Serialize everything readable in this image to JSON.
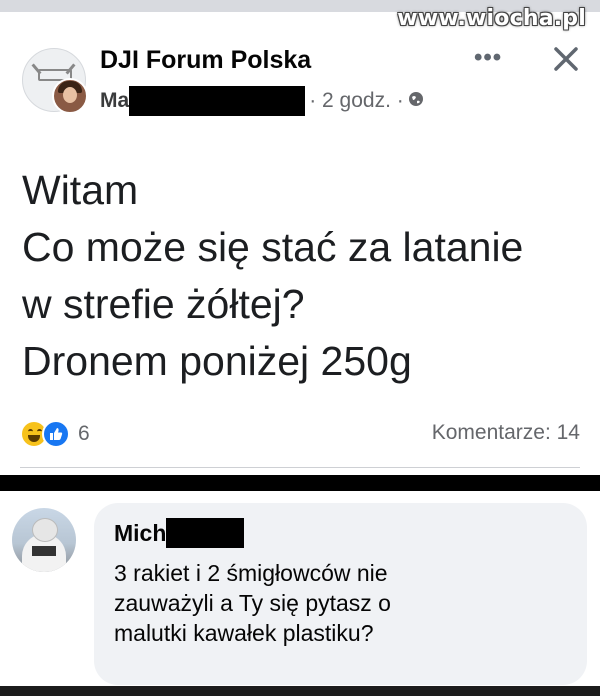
{
  "watermark": "www.wiocha.pl",
  "post": {
    "group_name": "DJI Forum Polska",
    "author_visible": "Ma",
    "time": "· 2 godz. ·",
    "lines": [
      "Witam",
      "Co może się stać za latanie",
      "w strefie żółtej?",
      "Dronem poniżej 250g"
    ],
    "reaction_count": "6",
    "comments_label": "Komentarze: 14"
  },
  "comment": {
    "author_visible": "Mich",
    "lines": [
      "3 rakiet i 2 śmigłowców nie",
      "zauważyli a Ty się pytasz o",
      "malutki kawałek plastiku?"
    ]
  },
  "icons": {
    "more": "more-icon",
    "close": "close-icon",
    "audience": "globe-icon",
    "reactions": [
      "haha-icon",
      "like-icon"
    ]
  },
  "colors": {
    "like_blue": "#1877f2",
    "haha_yellow": "#f7c21c",
    "meta_gray": "#65676b",
    "bubble_bg": "#f0f2f5"
  }
}
